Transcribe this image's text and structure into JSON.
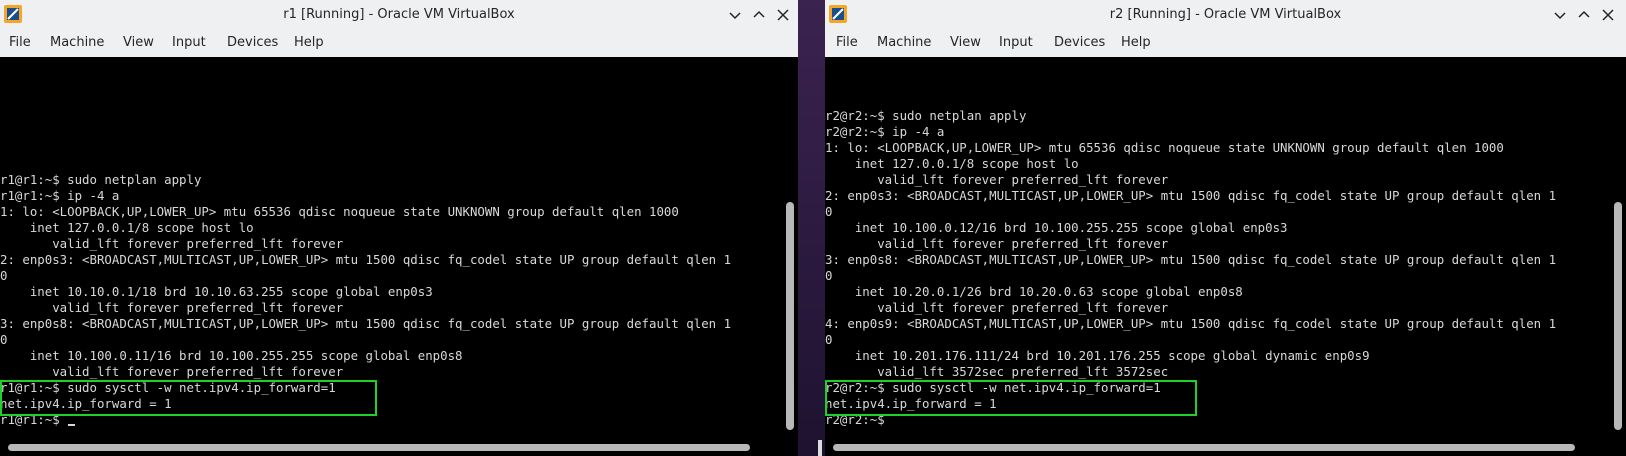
{
  "windows": [
    {
      "id": "r1",
      "title": "r1 [Running] - Oracle VM VirtualBox",
      "menu": [
        "File",
        "Machine",
        "View",
        "Input",
        "Devices",
        "Help"
      ],
      "terminal_lines": [
        "r1@r1:~$ sudo netplan apply",
        "r1@r1:~$ ip -4 a",
        "1: lo: <LOOPBACK,UP,LOWER_UP> mtu 65536 qdisc noqueue state UNKNOWN group default qlen 1000",
        "    inet 127.0.0.1/8 scope host lo",
        "       valid_lft forever preferred_lft forever",
        "2: enp0s3: <BROADCAST,MULTICAST,UP,LOWER_UP> mtu 1500 qdisc fq_codel state UP group default qlen 1",
        "0",
        "    inet 10.10.0.1/18 brd 10.10.63.255 scope global enp0s3",
        "       valid_lft forever preferred_lft forever",
        "3: enp0s8: <BROADCAST,MULTICAST,UP,LOWER_UP> mtu 1500 qdisc fq_codel state UP group default qlen 1",
        "0",
        "    inet 10.100.0.11/16 brd 10.100.255.255 scope global enp0s8",
        "       valid_lft forever preferred_lft forever",
        "r1@r1:~$ sudo sysctl -w net.ipv4.ip_forward=1",
        "net.ipv4.ip_forward = 1",
        "r1@r1:~$ "
      ]
    },
    {
      "id": "r2",
      "title": "r2 [Running] - Oracle VM VirtualBox",
      "menu": [
        "File",
        "Machine",
        "View",
        "Input",
        "Devices",
        "Help"
      ],
      "terminal_lines": [
        "r2@r2:~$ sudo netplan apply",
        "r2@r2:~$ ip -4 a",
        "1: lo: <LOOPBACK,UP,LOWER_UP> mtu 65536 qdisc noqueue state UNKNOWN group default qlen 1000",
        "    inet 127.0.0.1/8 scope host lo",
        "       valid_lft forever preferred_lft forever",
        "2: enp0s3: <BROADCAST,MULTICAST,UP,LOWER_UP> mtu 1500 qdisc fq_codel state UP group default qlen 1",
        "0",
        "    inet 10.100.0.12/16 brd 10.100.255.255 scope global enp0s3",
        "       valid_lft forever preferred_lft forever",
        "3: enp0s8: <BROADCAST,MULTICAST,UP,LOWER_UP> mtu 1500 qdisc fq_codel state UP group default qlen 1",
        "0",
        "    inet 10.20.0.1/26 brd 10.20.0.63 scope global enp0s8",
        "       valid_lft forever preferred_lft forever",
        "4: enp0s9: <BROADCAST,MULTICAST,UP,LOWER_UP> mtu 1500 qdisc fq_codel state UP group default qlen 1",
        "0",
        "    inet 10.201.176.111/24 brd 10.201.176.255 scope global dynamic enp0s9",
        "       valid_lft 3572sec preferred_lft 3572sec",
        "r2@r2:~$ sudo sysctl -w net.ipv4.ip_forward=1",
        "net.ipv4.ip_forward = 1",
        "r2@r2:~$ "
      ]
    }
  ],
  "colors": {
    "highlight": "#1fcf2a",
    "terminal_bg": "#000000",
    "terminal_fg": "#d8d8d8",
    "titlebar_bg": "#eff0f1"
  },
  "icons": [
    "virtualbox-icon",
    "minimize-icon",
    "maximize-icon",
    "close-icon"
  ]
}
